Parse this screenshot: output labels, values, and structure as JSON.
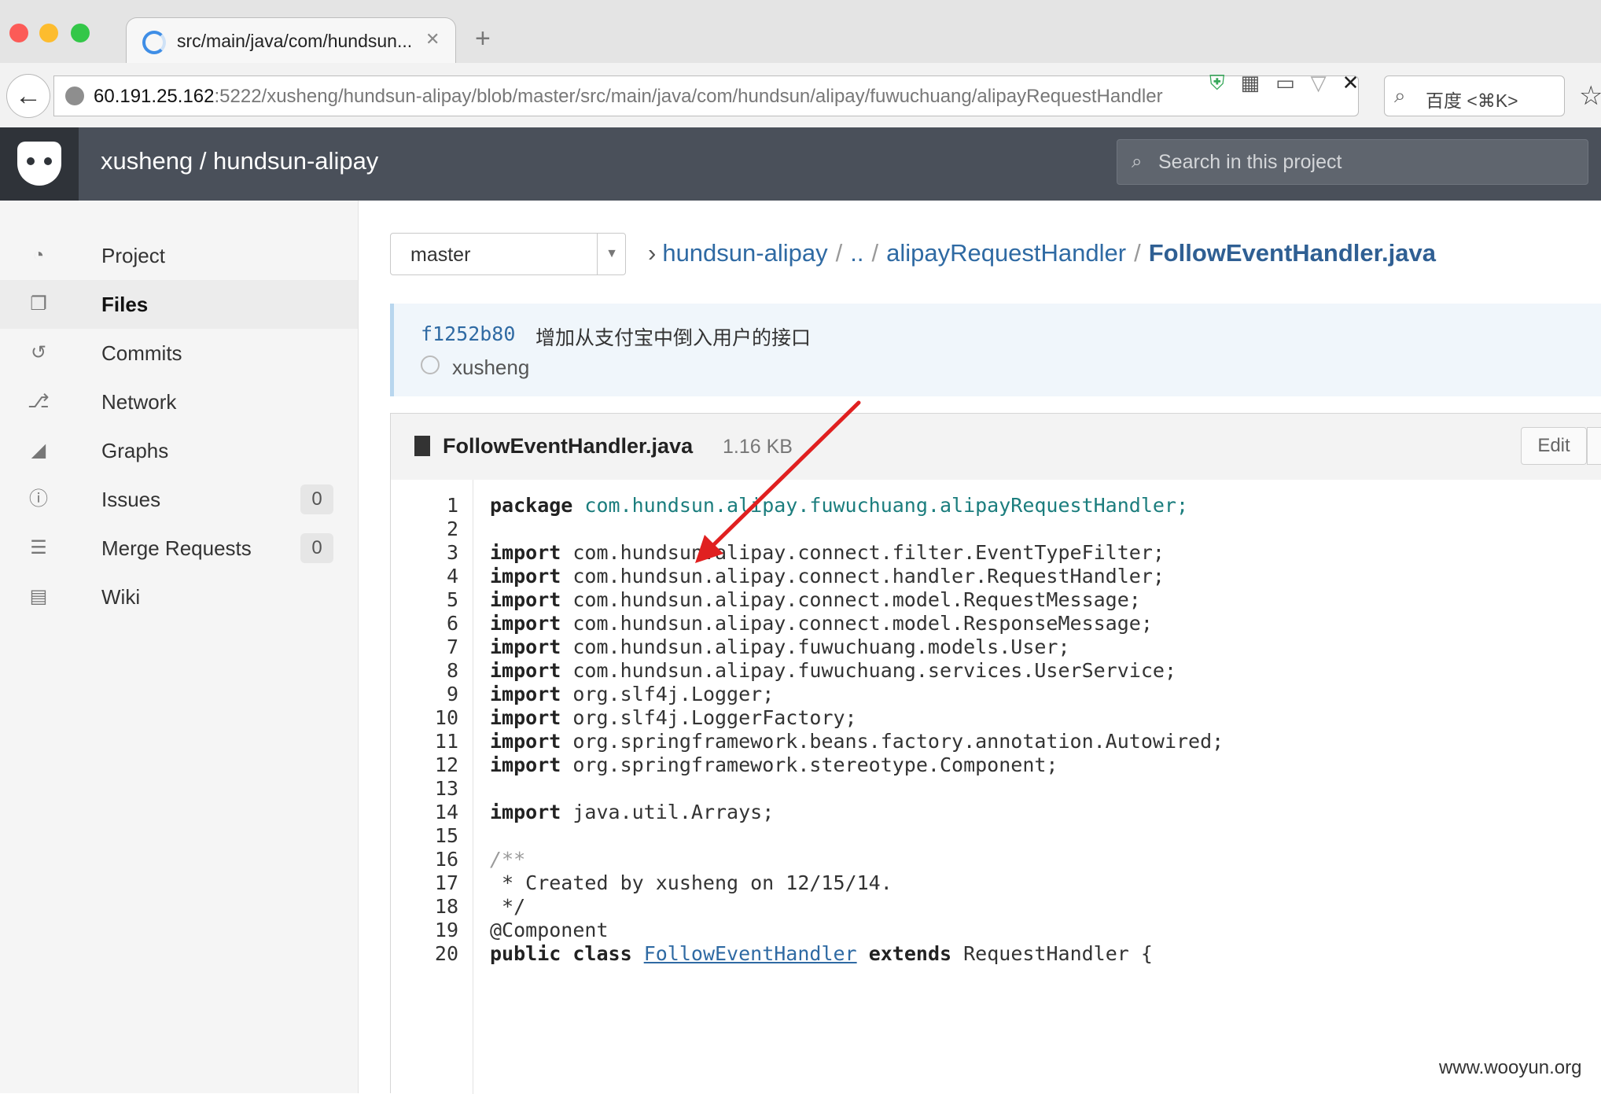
{
  "browser": {
    "tab_title": "src/main/java/com/hundsun...",
    "tab_close": "✕",
    "new_tab": "+",
    "url_host": "60.191.25.162",
    "url_rest": ":5222/xusheng/hundsun-alipay/blob/master/src/main/java/com/hundsun/alipay/fuwuchuang/alipayRequestHandler",
    "search_placeholder": "百度 <⌘K>",
    "icons": [
      "back-icon",
      "globe-icon",
      "shield-icon",
      "qr-code-icon",
      "reader-icon",
      "dropdown-icon",
      "stop-icon",
      "search-icon",
      "bookmark-star-icon"
    ]
  },
  "header": {
    "title": "xusheng / hundsun-alipay",
    "search_placeholder": "Search in this project"
  },
  "sidebar": {
    "items": [
      {
        "label": "Project",
        "icon": "dashboard-icon"
      },
      {
        "label": "Files",
        "icon": "files-icon",
        "active": true
      },
      {
        "label": "Commits",
        "icon": "history-icon"
      },
      {
        "label": "Network",
        "icon": "branch-icon"
      },
      {
        "label": "Graphs",
        "icon": "area-chart-icon"
      },
      {
        "label": "Issues",
        "icon": "exclamation-icon",
        "count": "0"
      },
      {
        "label": "Merge Requests",
        "icon": "list-icon",
        "count": "0"
      },
      {
        "label": "Wiki",
        "icon": "book-icon"
      }
    ]
  },
  "branch": {
    "selected": "master"
  },
  "breadcrumb": {
    "root": "hundsun-alipay",
    "up": "..",
    "folder": "alipayRequestHandler",
    "file": "FollowEventHandler.java"
  },
  "commit": {
    "sha": "f1252b80",
    "message": "增加从支付宝中倒入用户的接口",
    "author": "xusheng"
  },
  "file": {
    "name": "FollowEventHandler.java",
    "size": "1.16 KB",
    "edit_label": "Edit"
  },
  "code": {
    "line_numbers": [
      "1",
      "2",
      "3",
      "4",
      "5",
      "6",
      "7",
      "8",
      "9",
      "10",
      "11",
      "12",
      "13",
      "14",
      "15",
      "16",
      "17",
      "18",
      "19",
      "20"
    ],
    "lines": {
      "l1_kw": "package",
      "l1_pkg": "com.hundsun.alipay.fuwuchuang.alipayRequestHandler;",
      "l3_kw": "import",
      "l3_rest": "com.hundsun.alipay.connect.filter.EventTypeFilter;",
      "l4_kw": "import",
      "l4_rest": "com.hundsun.alipay.connect.handler.RequestHandler;",
      "l5_kw": "import",
      "l5_rest": "com.hundsun.alipay.connect.model.RequestMessage;",
      "l6_kw": "import",
      "l6_rest": "com.hundsun.alipay.connect.model.ResponseMessage;",
      "l7_kw": "import",
      "l7_rest": "com.hundsun.alipay.fuwuchuang.models.User;",
      "l8_kw": "import",
      "l8_rest": "com.hundsun.alipay.fuwuchuang.services.UserService;",
      "l9_kw": "import",
      "l9_rest": "org.slf4j.Logger;",
      "l10_kw": "import",
      "l10_rest": "org.slf4j.LoggerFactory;",
      "l11_kw": "import",
      "l11_rest": "org.springframework.beans.factory.annotation.Autowired;",
      "l12_kw": "import",
      "l12_rest": "org.springframework.stereotype.Component;",
      "l14_kw": "import",
      "l14_rest": "java.util.Arrays;",
      "l16": "/**",
      "l17": " * Created by xusheng on 12/15/14.",
      "l18": " */",
      "l19": "@Component",
      "l20_a": "public class",
      "l20_b": "FollowEventHandler",
      "l20_c": "extends",
      "l20_d": "RequestHandler {"
    }
  },
  "watermark": "www.wooyun.org",
  "colors": {
    "header_bg": "#4a505a",
    "link": "#2f6aa3",
    "annotation_arrow": "#e02020"
  }
}
